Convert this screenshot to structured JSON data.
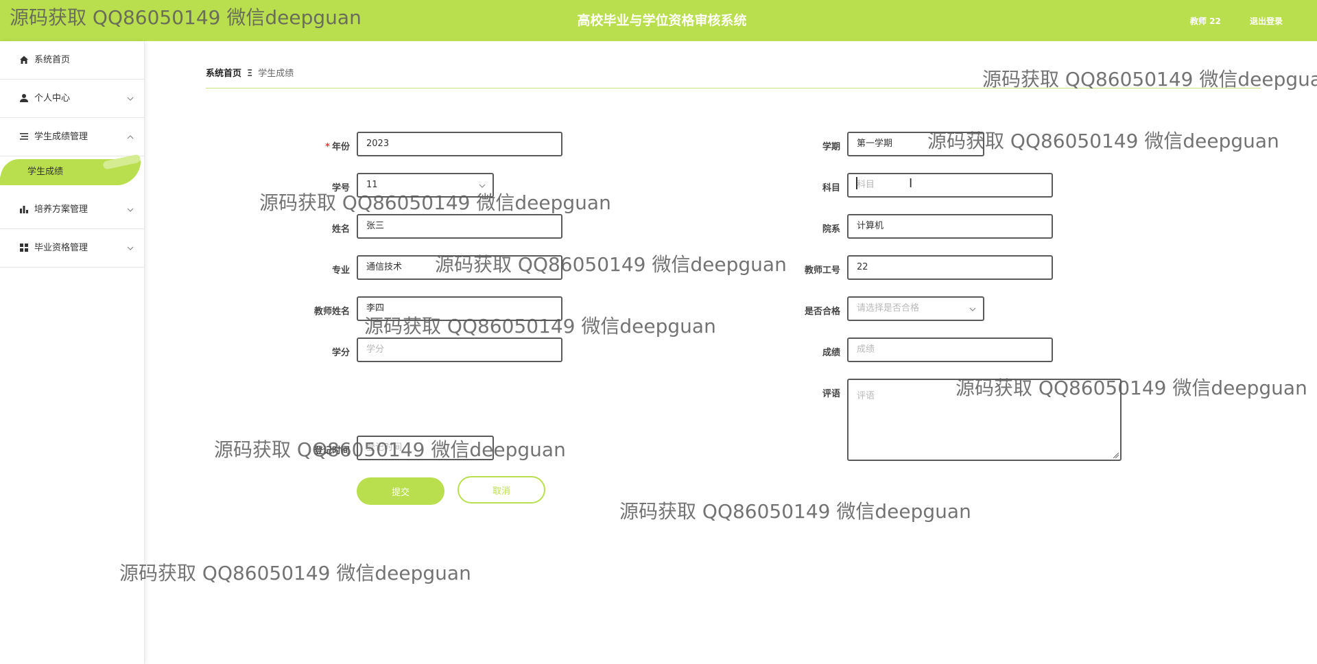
{
  "app": {
    "title": "高校毕业与学位资格审核系统",
    "user": "教师 22",
    "logout": "退出登录"
  },
  "sidebar": {
    "items": [
      {
        "label": "系统首页",
        "icon": "home-icon"
      },
      {
        "label": "个人中心",
        "icon": "user-icon"
      },
      {
        "label": "学生成绩管理",
        "icon": "list-icon",
        "expanded": true
      },
      {
        "label": "培养方案管理",
        "icon": "bar-chart-icon"
      },
      {
        "label": "毕业资格管理",
        "icon": "grid-icon"
      }
    ],
    "active_sub": "学生成绩"
  },
  "breadcrumb": {
    "home": "系统首页",
    "separator": "Ξ",
    "current": "学生成绩"
  },
  "form": {
    "year": {
      "label": "年份",
      "value": "2023",
      "required": true
    },
    "term": {
      "label": "学期",
      "value": "第一学期"
    },
    "student_no": {
      "label": "学号",
      "value": "11"
    },
    "subject": {
      "label": "科目",
      "placeholder": "科目"
    },
    "name": {
      "label": "姓名",
      "value": "张三"
    },
    "dept": {
      "label": "院系",
      "value": "计算机"
    },
    "major": {
      "label": "专业",
      "value": "通信技术"
    },
    "teacher_no": {
      "label": "教师工号",
      "value": "22"
    },
    "teacher_name": {
      "label": "教师姓名",
      "value": "李四"
    },
    "qualified": {
      "label": "是否合格",
      "placeholder": "请选择是否合格"
    },
    "credit": {
      "label": "学分",
      "placeholder": "学分"
    },
    "score": {
      "label": "成绩",
      "placeholder": "成绩"
    },
    "comment": {
      "label": "评语",
      "placeholder": "评语"
    },
    "reg_time": {
      "label": "登记时间",
      "placeholder": "登记时间"
    },
    "submit": "提交",
    "cancel": "取消"
  },
  "watermark": "源码获取 QQ86050149 微信deepguan",
  "colors": {
    "accent": "#b9df4e",
    "required": "#e53935"
  }
}
